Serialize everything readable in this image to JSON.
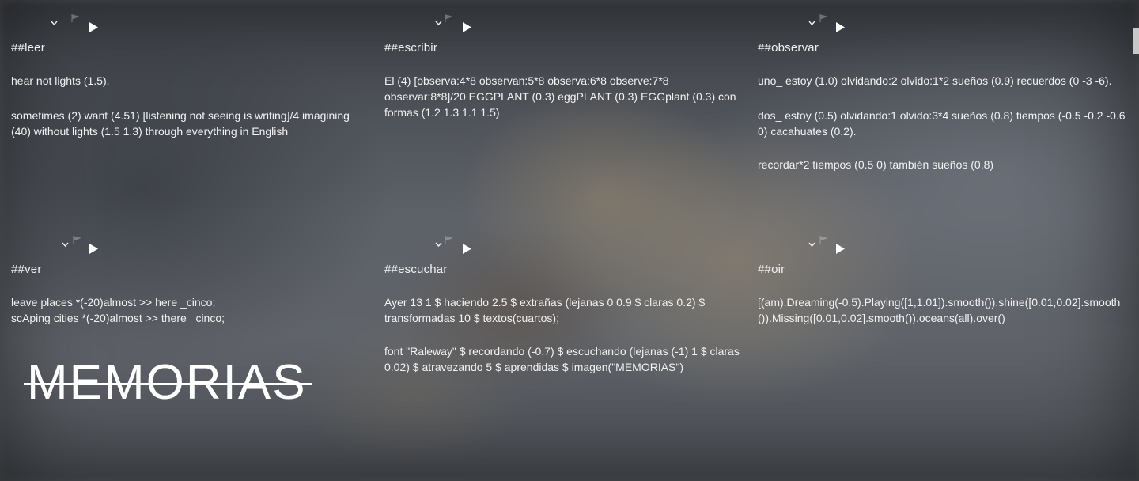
{
  "panels": [
    {
      "id": "leer",
      "title": "##leer",
      "ghost": "##leer",
      "paragraphs": [
        "hear not lights (1.5).",
        "sometimes (2) want (4.51) [listening not seeing is writing]/4 imagining (40) without lights (1.5 1.3) through everything in English"
      ]
    },
    {
      "id": "escribir",
      "title": "##escribir",
      "ghost": "##escribir",
      "paragraphs": [
        "El (4) [observa:4*8 observan:5*8 observa:6*8 observe:7*8 observar:8*8]/20 EGGPLANT (0.3) eggPLANT (0.3) EGGplant (0.3) con formas (1.2 1.3 1.1 1.5)"
      ]
    },
    {
      "id": "observar",
      "title": "##observar",
      "ghost": "##observar",
      "paragraphs": [
        "uno_ estoy (1.0) olvidando:2 olvido:1*2 sueños (0.9) recuerdos (0 -3 -6).",
        "dos_ estoy (0.5) olvidando:1 olvido:3*4 sueños (0.8) tiempos (-0.5 -0.2 -0.6 0) cacahuates (0.2).",
        "recordar*2 tiempos (0.5 0) también sueños (0.8)"
      ]
    },
    {
      "id": "ver",
      "title": "##ver",
      "ghost": "##ver",
      "paragraphs": [
        "leave places *(-20)almost >> here _cinco; scAping cities *(-20)almost >> there _cinco;"
      ]
    },
    {
      "id": "escuchar",
      "title": "##escuchar",
      "ghost": "##escuchar",
      "paragraphs": [
        "Ayer 13 1 $ haciendo 2.5 $ extrañas (lejanas 0 0.9 $ claras 0.2) $ transformadas 10 $ textos(cuartos);",
        "font \"Raleway\" $ recordando (-0.7) $ escuchando (lejanas (-1) 1 $ claras 0.02) $ atravezando 5 $ aprendidas $ imagen(\"MEMORIAS\")"
      ]
    },
    {
      "id": "oir",
      "title": "##oir",
      "ghost": "##oir",
      "paragraphs": [
        "[(am).Dreaming(-0.5).Playing([1,1.01]).smooth()).shine([0.01,0.02].smooth()).Missing([0.01,0.02].smooth()).oceans(all).over()"
      ]
    }
  ],
  "overlay_title": "MEMORIAS",
  "icons": {
    "collapse": "chevron-down-icon",
    "play": "play-icon",
    "mini": "mini-flag-icon"
  },
  "colors": {
    "text": "#f2f2f2",
    "background": "#5c5f64"
  }
}
